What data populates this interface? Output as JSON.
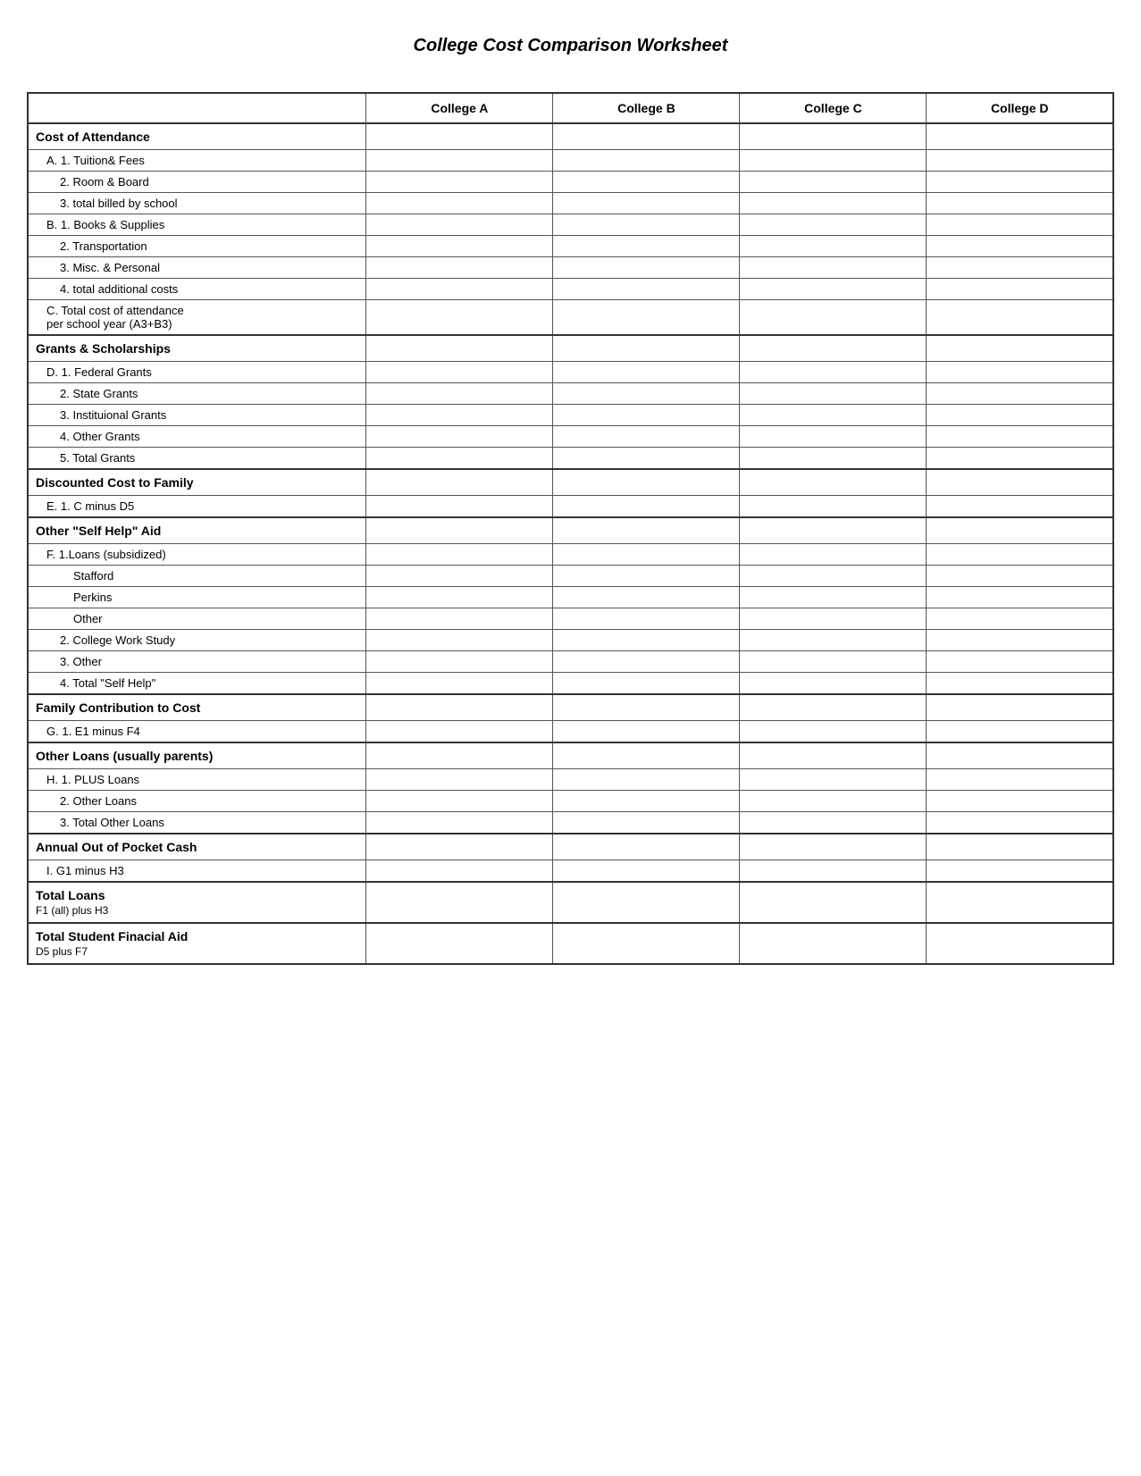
{
  "title": "College Cost Comparison Worksheet",
  "columns": {
    "label": "",
    "col_a": "College A",
    "col_b": "College B",
    "col_c": "College C",
    "col_d": "College D"
  },
  "sections": [
    {
      "id": "cost-of-attendance",
      "header": "Cost of Attendance",
      "rows": [
        {
          "id": "a1",
          "label": "A.  1. Tuition& Fees",
          "indent": 1
        },
        {
          "id": "a2",
          "label": "2. Room & Board",
          "indent": 2
        },
        {
          "id": "a3",
          "label": "3. total billed by school",
          "indent": 2
        },
        {
          "id": "b1",
          "label": "B.  1. Books & Supplies",
          "indent": 1
        },
        {
          "id": "b2",
          "label": "2. Transportation",
          "indent": 2
        },
        {
          "id": "b3",
          "label": "3. Misc. & Personal",
          "indent": 2
        },
        {
          "id": "b4",
          "label": "4. total additional costs",
          "indent": 2
        },
        {
          "id": "c1",
          "label": "C.  Total cost of attendance\n    per school year (A3+B3)",
          "indent": 1
        }
      ]
    },
    {
      "id": "grants-scholarships",
      "header": "Grants & Scholarships",
      "rows": [
        {
          "id": "d1",
          "label": "D.  1. Federal Grants",
          "indent": 1
        },
        {
          "id": "d2",
          "label": "2. State Grants",
          "indent": 2
        },
        {
          "id": "d3",
          "label": "3. Instituional Grants",
          "indent": 2
        },
        {
          "id": "d4",
          "label": "4. Other Grants",
          "indent": 2
        },
        {
          "id": "d5",
          "label": "5. Total Grants",
          "indent": 2
        }
      ]
    },
    {
      "id": "discounted-cost",
      "header": "Discounted Cost to Family",
      "rows": [
        {
          "id": "e1",
          "label": "E.  1. C minus D5",
          "indent": 1
        }
      ]
    },
    {
      "id": "self-help-aid",
      "header": "Other \"Self Help\" Aid",
      "rows": [
        {
          "id": "f1",
          "label": "F.   1.Loans (subsidized)",
          "indent": 1
        },
        {
          "id": "f1a",
          "label": "Stafford",
          "indent": 3
        },
        {
          "id": "f1b",
          "label": "Perkins",
          "indent": 3
        },
        {
          "id": "f1c",
          "label": "Other",
          "indent": 3
        },
        {
          "id": "f2",
          "label": "2. College Work Study",
          "indent": 2
        },
        {
          "id": "f3",
          "label": "3. Other",
          "indent": 2
        },
        {
          "id": "f4",
          "label": "4. Total \"Self Help\"",
          "indent": 2
        }
      ]
    },
    {
      "id": "family-contribution",
      "header": "Family Contribution to Cost",
      "rows": [
        {
          "id": "g1",
          "label": "G.  1. E1 minus F4",
          "indent": 1
        }
      ]
    },
    {
      "id": "other-loans",
      "header": "Other Loans (usually parents)",
      "rows": [
        {
          "id": "h1",
          "label": "H.  1. PLUS Loans",
          "indent": 1
        },
        {
          "id": "h2",
          "label": "2. Other Loans",
          "indent": 2
        },
        {
          "id": "h3",
          "label": "3. Total Other Loans",
          "indent": 2
        }
      ]
    },
    {
      "id": "annual-out-of-pocket",
      "header": "Annual Out of Pocket Cash",
      "rows": [
        {
          "id": "i1",
          "label": "I.   G1 minus H3",
          "indent": 1
        }
      ]
    },
    {
      "id": "total-loans",
      "header": "Total Loans",
      "subheader": "F1 (all) plus H3",
      "rows": []
    },
    {
      "id": "total-student-aid",
      "header": "Total Student Finacial Aid",
      "subheader": "D5 plus F7",
      "rows": []
    }
  ]
}
